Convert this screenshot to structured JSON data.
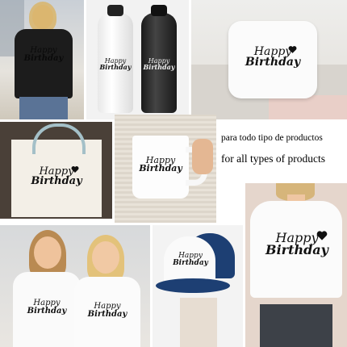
{
  "captions": {
    "spanish": "para todo tipo de productos",
    "english": "for all types of products"
  },
  "design": {
    "line1": "Happy",
    "line2": "Birthday",
    "icon": "heart-icon"
  },
  "colors": {
    "ink": "#111111",
    "background": "#ffffff",
    "tshirt_black": "#1c1c1c",
    "bottle_black": "#2a2a2a",
    "cap_blue": "#1d3f73"
  },
  "products": [
    "black-tshirt",
    "white-water-bottle",
    "black-water-bottle",
    "white-pillow",
    "tote-bag",
    "mug",
    "two-white-tshirts",
    "trucker-cap",
    "white-crop-tshirt"
  ]
}
